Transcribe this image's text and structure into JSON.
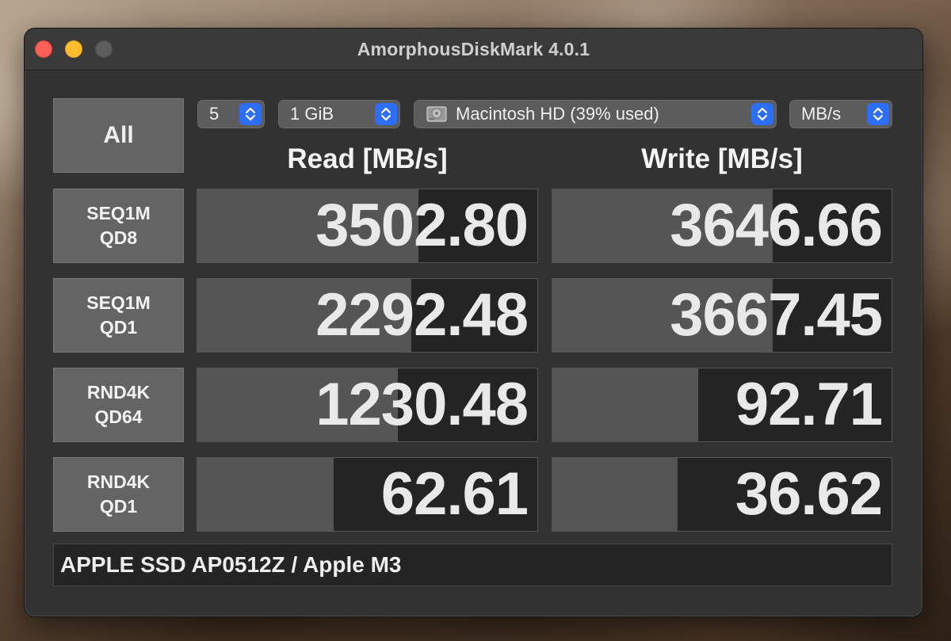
{
  "window": {
    "title": "AmorphousDiskMark 4.0.1"
  },
  "controls": {
    "all_label": "All",
    "count": "5",
    "size": "1 GiB",
    "disk": "Macintosh HD (39% used)",
    "unit": "MB/s"
  },
  "headers": {
    "read": "Read [MB/s]",
    "write": "Write [MB/s]"
  },
  "results": [
    {
      "line1": "SEQ1M",
      "line2": "QD8",
      "read": "3502.80",
      "write": "3646.66",
      "read_bar": 0.65,
      "write_bar": 0.65
    },
    {
      "line1": "SEQ1M",
      "line2": "QD1",
      "read": "2292.48",
      "write": "3667.45",
      "read_bar": 0.63,
      "write_bar": 0.65
    },
    {
      "line1": "RND4K",
      "line2": "QD64",
      "read": "1230.48",
      "write": "92.71",
      "read_bar": 0.59,
      "write_bar": 0.43
    },
    {
      "line1": "RND4K",
      "line2": "QD1",
      "read": "62.61",
      "write": "36.62",
      "read_bar": 0.4,
      "write_bar": 0.37
    }
  ],
  "footer": {
    "device": "APPLE SSD AP0512Z / Apple M3"
  },
  "icons": {
    "stepper": "updown-chevron-icon",
    "disk": "hard-disk-icon"
  },
  "colors": {
    "accent": "#2d6ef6",
    "bar": "#555555",
    "cell_bg": "#242424"
  }
}
